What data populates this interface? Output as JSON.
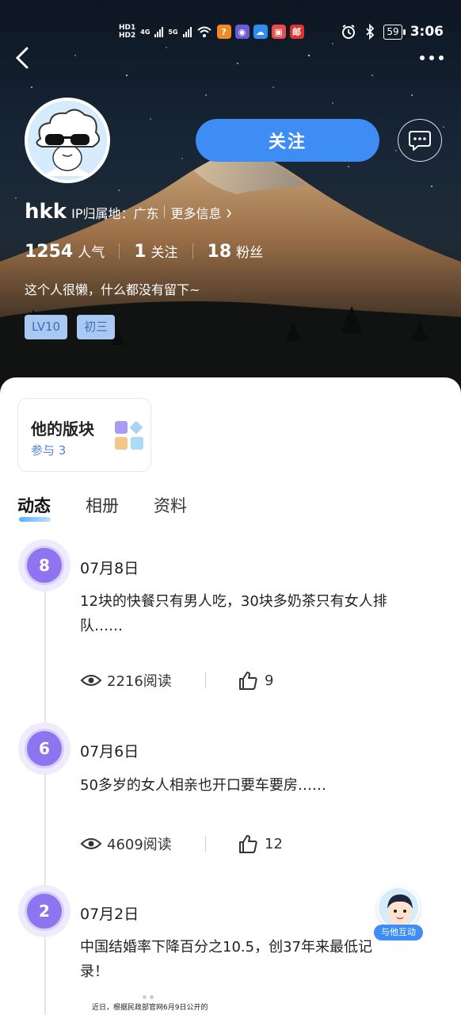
{
  "status_bar": {
    "hd1": "HD1",
    "hd2": "HD2",
    "net1": "4G",
    "net2": "5G",
    "app_icons": [
      {
        "name": "key-app-icon",
        "glyph": "?",
        "color": "#f08a24"
      },
      {
        "name": "app2-icon",
        "glyph": "◉",
        "color": "#6b5bd6"
      },
      {
        "name": "cloud-app-icon",
        "glyph": "☁",
        "color": "#2f8df0"
      },
      {
        "name": "app4-icon",
        "glyph": "▣",
        "color": "#e84c4c"
      },
      {
        "name": "mail-app-icon",
        "glyph": "邮",
        "color": "#e0332c"
      }
    ],
    "battery": "59",
    "time": "3:06"
  },
  "profile": {
    "username": "hkk",
    "ip_location": "IP归属地：广东",
    "more_info": "更多信息",
    "follow_label": "关注",
    "stats": [
      {
        "value": "1254",
        "label": "人气"
      },
      {
        "value": "1",
        "label": "关注"
      },
      {
        "value": "18",
        "label": "粉丝"
      }
    ],
    "bio": "这个人很懒，什么都没有留下~",
    "tags": [
      "LV10",
      "初三"
    ]
  },
  "board": {
    "title": "他的版块",
    "subtitle": "参与 3"
  },
  "tabs": [
    "动态",
    "相册",
    "资料"
  ],
  "active_tab": "动态",
  "posts": [
    {
      "badge": "8",
      "date": "07月8日",
      "text": "12块的快餐只有男人吃，30块多奶茶只有女人排队……",
      "views": "2216阅读",
      "likes": "9"
    },
    {
      "badge": "6",
      "date": "07月6日",
      "text": "50多岁的女人相亲也开口要车要房……",
      "views": "4609阅读",
      "likes": "12"
    },
    {
      "badge": "2",
      "date": "07月2日",
      "text": "中国结婚率下降百分之10.5，创37年来最低记录！",
      "views": "",
      "likes": ""
    }
  ],
  "news_snippet": "近日，根据民政部官网6月9日公开的",
  "float_button": {
    "label": "与他互动"
  }
}
